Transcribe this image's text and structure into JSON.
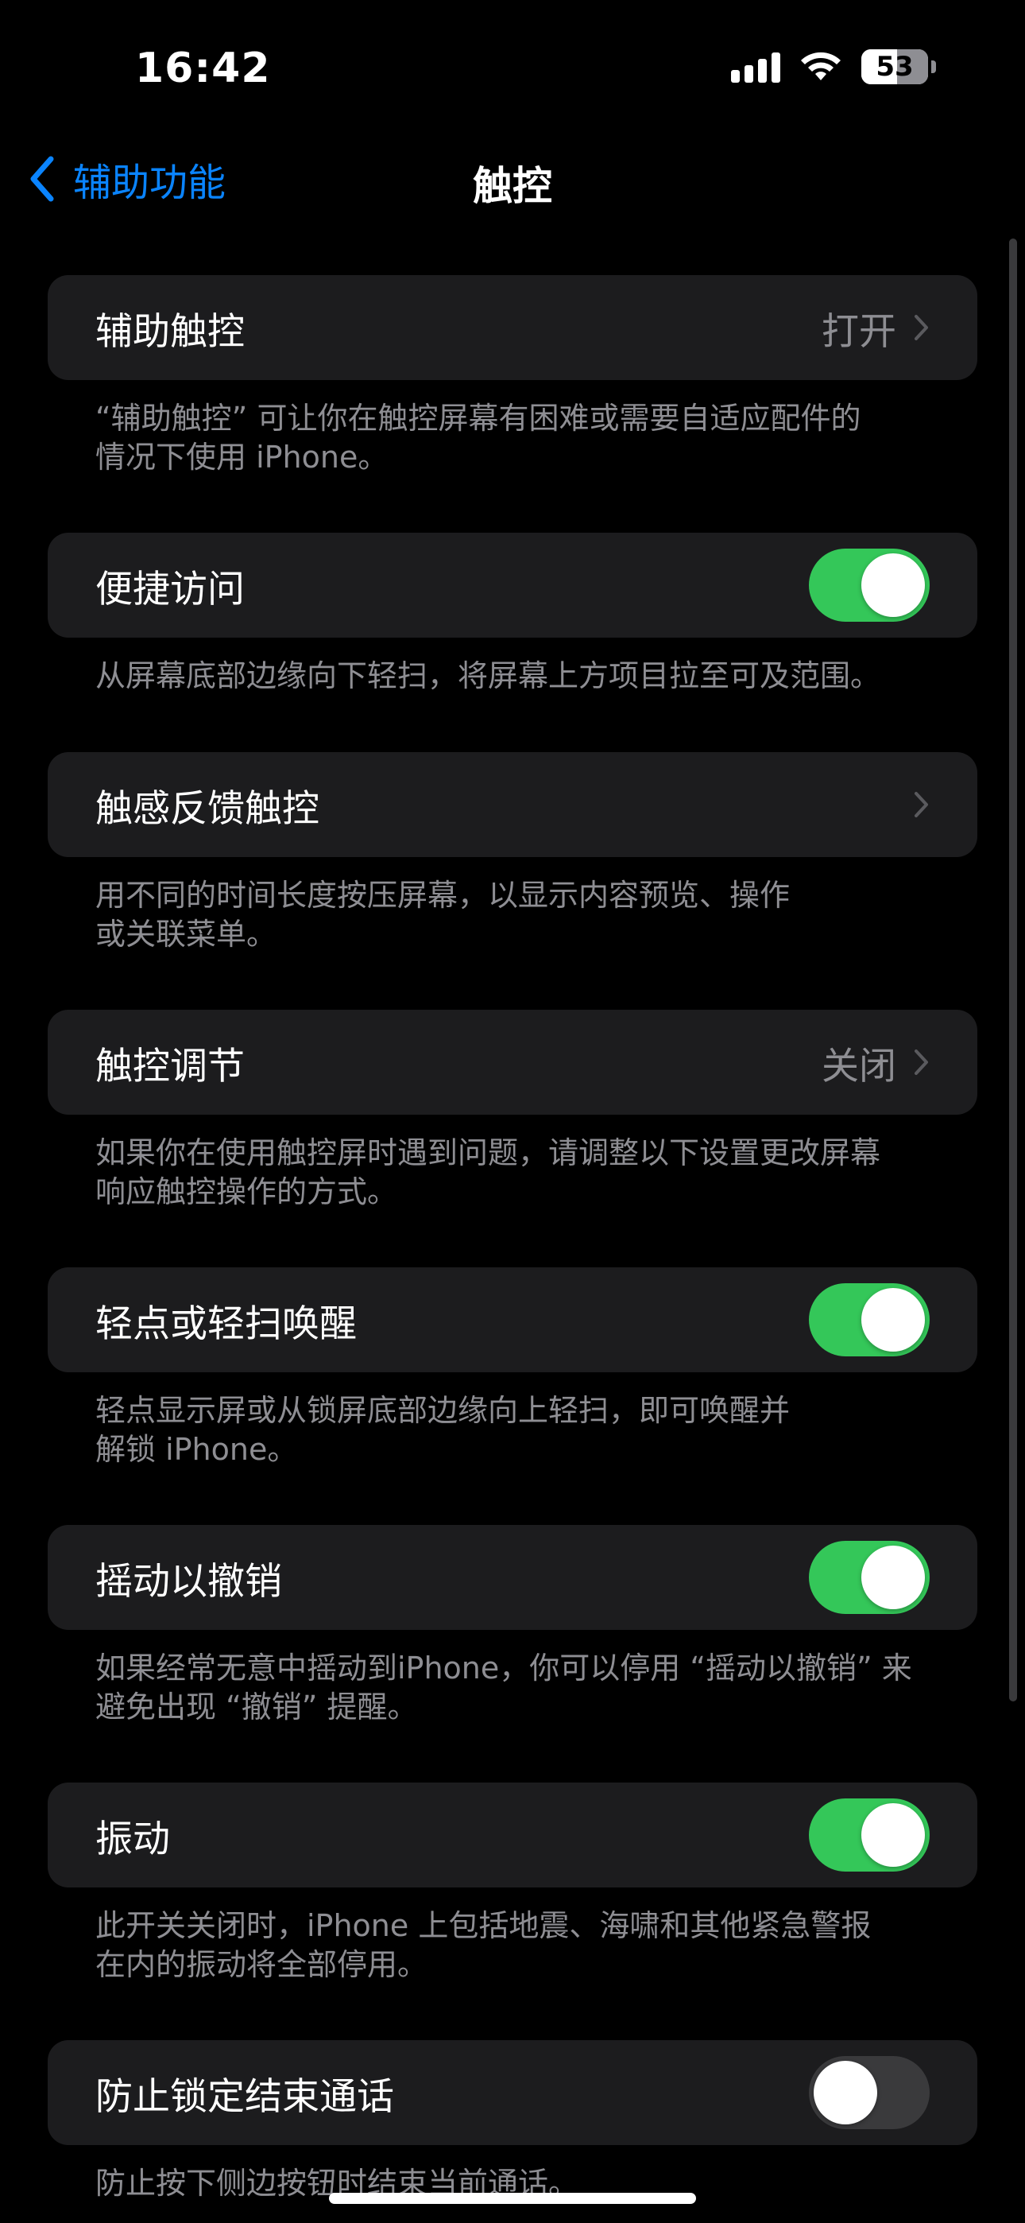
{
  "status_bar": {
    "time": "16:42",
    "battery": "53"
  },
  "nav": {
    "back_label": "辅助功能",
    "title": "触控"
  },
  "groups": [
    {
      "label": "辅助触控",
      "value": "打开",
      "kind": "link",
      "footer": [
        "“辅助触控” 可让你在触控屏幕有困难或需要自适应配件的",
        "情况下使用 iPhone。"
      ]
    },
    {
      "label": "便捷访问",
      "kind": "toggle",
      "on": true,
      "footer": [
        "从屏幕底部边缘向下轻扫，将屏幕上方项目拉至可及范围。"
      ]
    },
    {
      "label": "触感反馈触控",
      "value": "",
      "kind": "link",
      "footer": [
        "用不同的时间长度按压屏幕，以显示内容预览、操作",
        "或关联菜单。"
      ]
    },
    {
      "label": "触控调节",
      "value": "关闭",
      "kind": "link",
      "footer": [
        "如果你在使用触控屏时遇到问题，请调整以下设置更改屏幕",
        "响应触控操作的方式。"
      ]
    },
    {
      "label": "轻点或轻扫唤醒",
      "kind": "toggle",
      "on": true,
      "footer": [
        "轻点显示屏或从锁屏底部边缘向上轻扫，即可唤醒并",
        "解锁 iPhone。"
      ]
    },
    {
      "label": "摇动以撤销",
      "kind": "toggle",
      "on": true,
      "footer": [
        "如果经常无意中摇动到iPhone，你可以停用 “摇动以撤销” 来",
        "避免出现 “撤销” 提醒。"
      ]
    },
    {
      "label": "振动",
      "kind": "toggle",
      "on": true,
      "footer": [
        "此开关关闭时，iPhone 上包括地震、海啸和其他紧急警报",
        "在内的振动将全部停用。"
      ]
    },
    {
      "label": "防止锁定结束通话",
      "kind": "toggle",
      "on": false,
      "footer": [
        "防止按下侧边按钮时结束当前通话。"
      ]
    }
  ],
  "colors": {
    "accent": "#0a84ff",
    "toggle_on": "#34c759",
    "cell_bg": "#1c1c1e",
    "secondary_text": "#8e8e93"
  }
}
